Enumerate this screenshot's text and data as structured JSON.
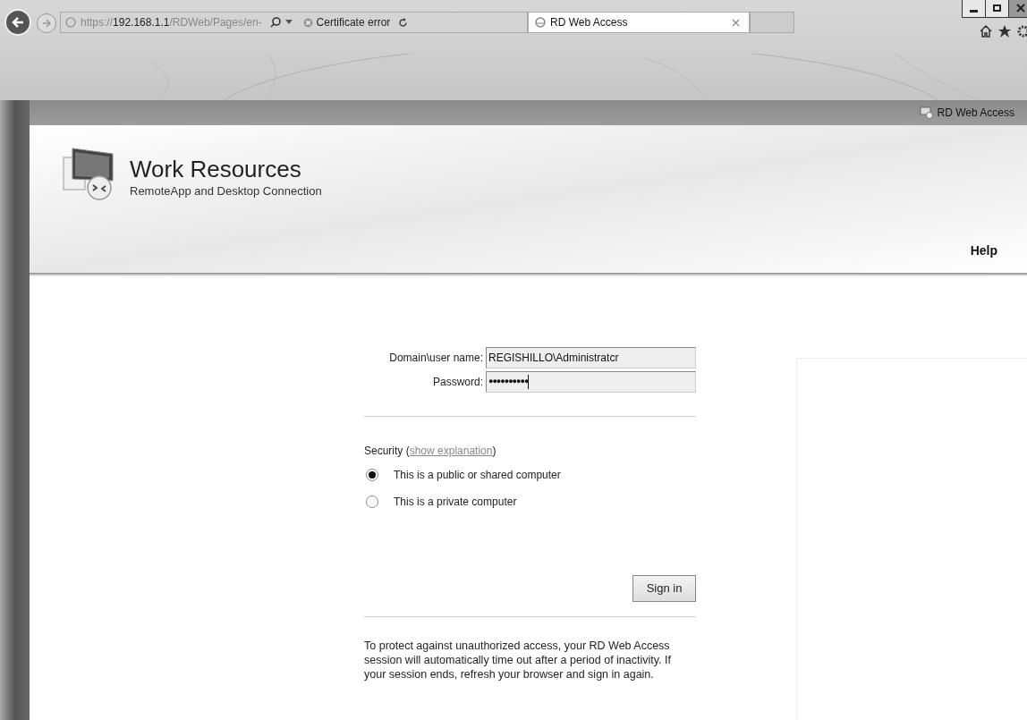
{
  "browser": {
    "address": {
      "host_prefix": "https://",
      "host": "192.168.1.1",
      "path": "/RDWeb/Pages/en-"
    },
    "certificate": "Certificate error",
    "tabs": [
      {
        "title": "RD Web Access",
        "selected": true
      }
    ]
  },
  "page": {
    "top_bar_label": "RD Web Access",
    "title": "Work Resources",
    "subtitle": "RemoteApp and Desktop Connection",
    "help": "Help"
  },
  "form": {
    "fields": [
      {
        "label": "Domain\\user name:",
        "value": "REGISHILLO\\Administratcr",
        "kind": "text"
      },
      {
        "label": "Password:",
        "value": "●●●●●●●●●●",
        "kind": "password"
      }
    ],
    "security_label": "Security (",
    "security_link": "show explanation",
    "security_close": ")",
    "options": [
      {
        "label": "This is a public or shared computer",
        "selected": true
      },
      {
        "label": "This is a private computer",
        "selected": false
      }
    ],
    "button": "Sign in",
    "notice": "To protect against unauthorized access, your RD Web Access session will automatically time out after a period of inactivity. If your session ends, refresh your browser and sign in again."
  }
}
